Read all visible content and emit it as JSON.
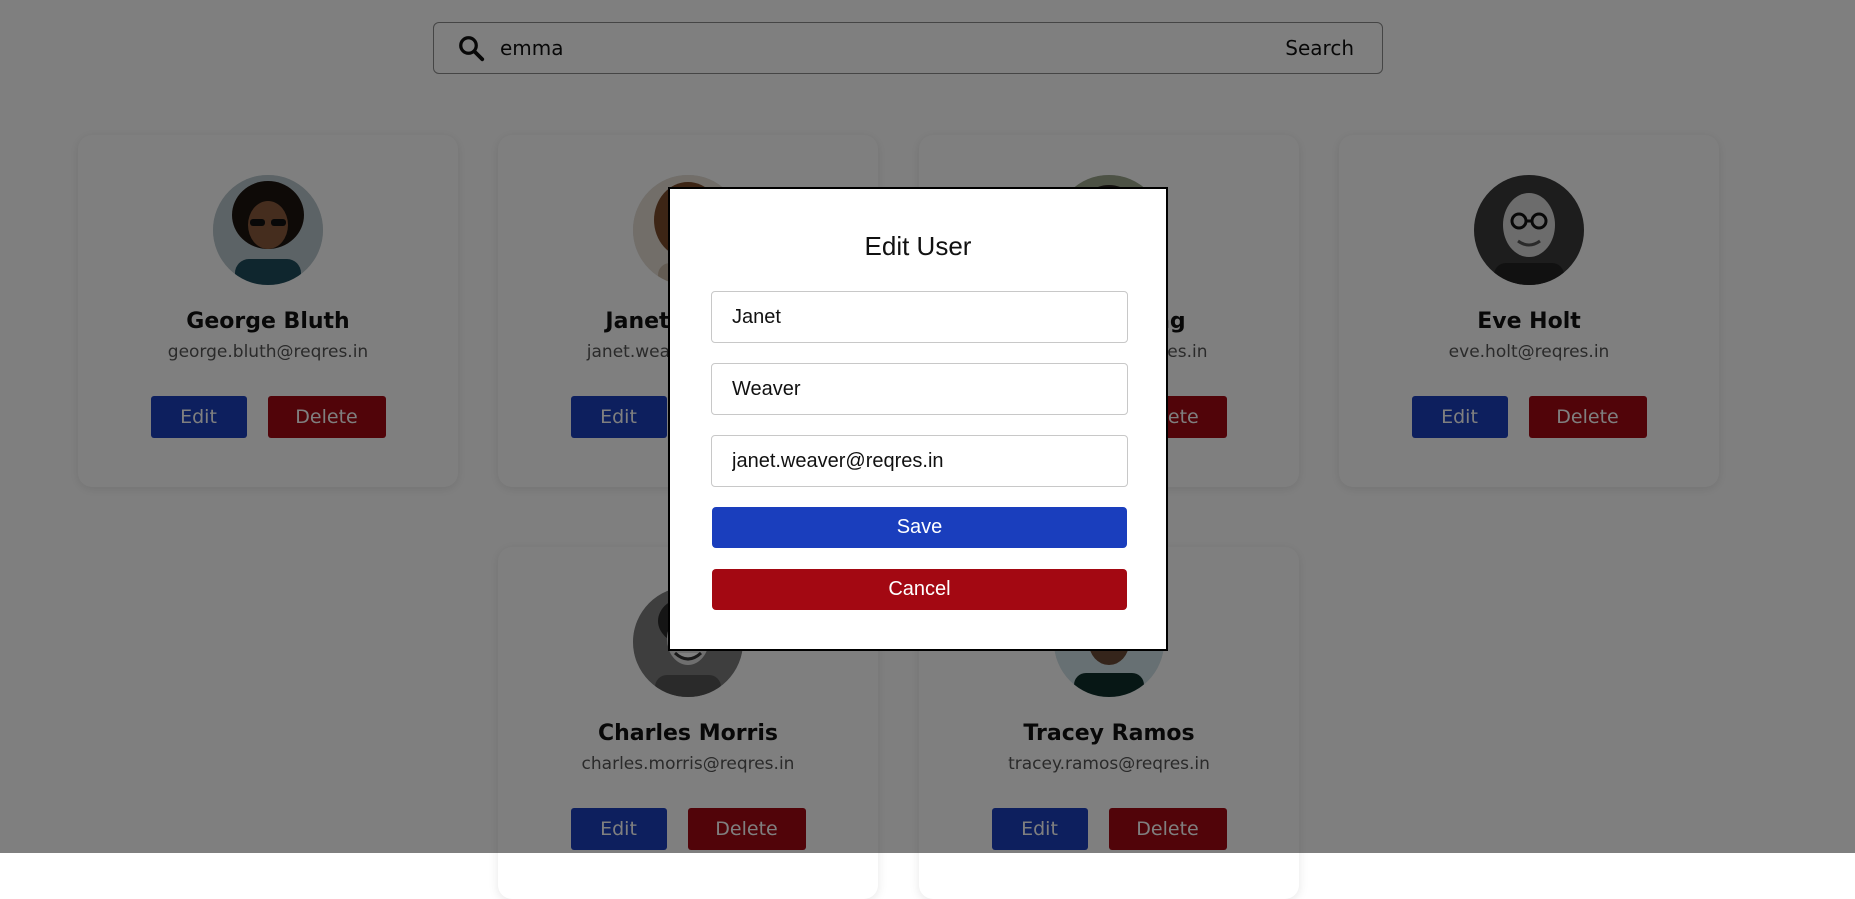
{
  "search": {
    "value": "emma",
    "button_label": "Search"
  },
  "users": [
    {
      "name": "George Bluth",
      "email": "george.bluth@reqres.in"
    },
    {
      "name": "Janet Weaver",
      "email": "janet.weaver@reqres.in"
    },
    {
      "name": "Emma Wong",
      "email": "emma.wong@reqres.in"
    },
    {
      "name": "Eve Holt",
      "email": "eve.holt@reqres.in"
    },
    {
      "name": "Charles Morris",
      "email": "charles.morris@reqres.in"
    },
    {
      "name": "Tracey Ramos",
      "email": "tracey.ramos@reqres.in"
    }
  ],
  "card_actions": {
    "edit_label": "Edit",
    "delete_label": "Delete"
  },
  "modal": {
    "title": "Edit User",
    "first_name": "Janet",
    "last_name": "Weaver",
    "email": "janet.weaver@reqres.in",
    "save_label": "Save",
    "cancel_label": "Cancel"
  },
  "colors": {
    "primary": "#1a3ebd",
    "danger": "#a30812",
    "overlay": "rgba(0,0,0,0.5)"
  }
}
